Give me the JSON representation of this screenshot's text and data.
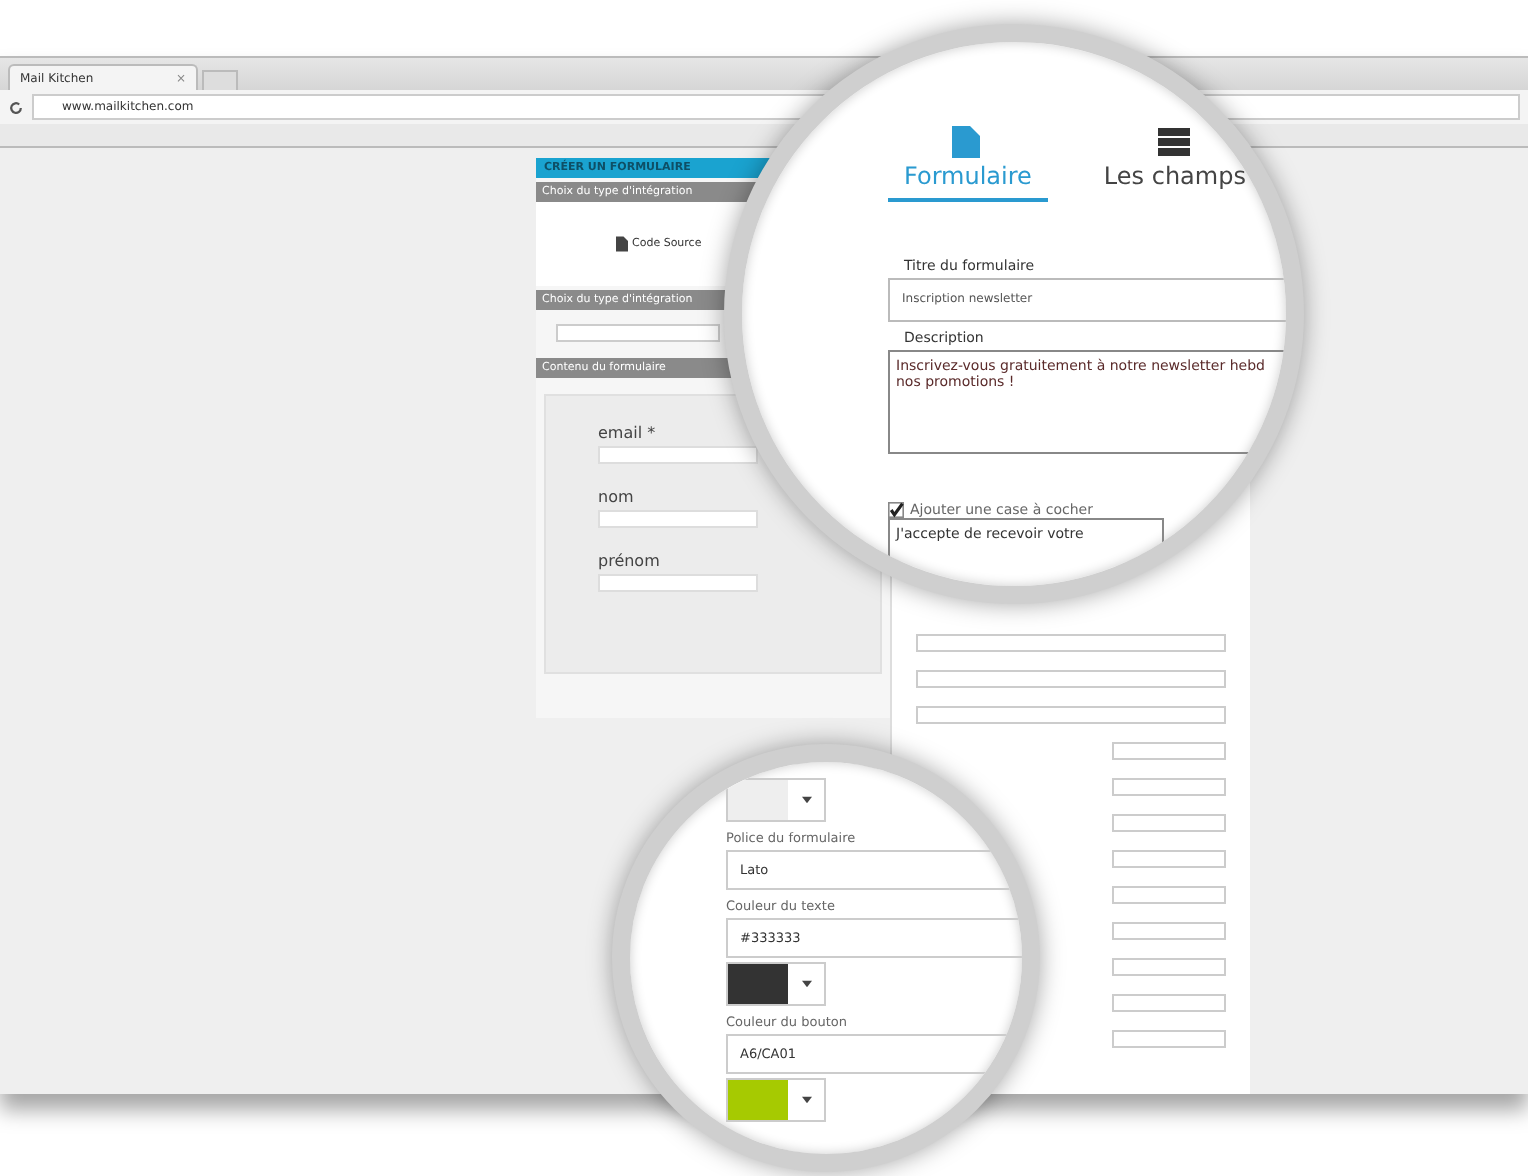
{
  "browser": {
    "tab_title": "Mail Kitchen",
    "tab_close": "×",
    "url": "www.mailkitchen.com"
  },
  "builder": {
    "header": "CRÉER UN FORMULAIRE",
    "sections": [
      {
        "title": "Choix du type d'intégration",
        "kind": "code",
        "link": "Code Source"
      },
      {
        "title": "Choix du type d'intégration",
        "kind": "select"
      },
      {
        "title": "Contenu du formulaire",
        "kind": "preview",
        "fields": [
          {
            "label": "email *"
          },
          {
            "label": "nom"
          },
          {
            "label": "prénom"
          }
        ]
      }
    ]
  },
  "magnifier_top": {
    "tabs": [
      {
        "label": "Formulaire",
        "selected": true,
        "kind": "form"
      },
      {
        "label": "Les champs",
        "selected": false,
        "kind": "list"
      }
    ],
    "title_label": "Titre du formulaire",
    "title_value": "Inscription newsletter",
    "description_label": "Description",
    "description_value": "Inscrivez-vous gratuitement à notre newsletter hebd",
    "description_value_2": "nos promotions !",
    "checkbox": {
      "label": "Ajouter une case à cocher",
      "checked": true
    },
    "consent_value": "J'accepte de recevoir votre"
  },
  "magnifier_bottom": {
    "font_label": "Police du formulaire",
    "font_value": "Lato",
    "text_color_label": "Couleur du texte",
    "text_color_value": "#333333",
    "button_color_label": "Couleur du bouton",
    "button_color_value": "A6/CA01"
  }
}
